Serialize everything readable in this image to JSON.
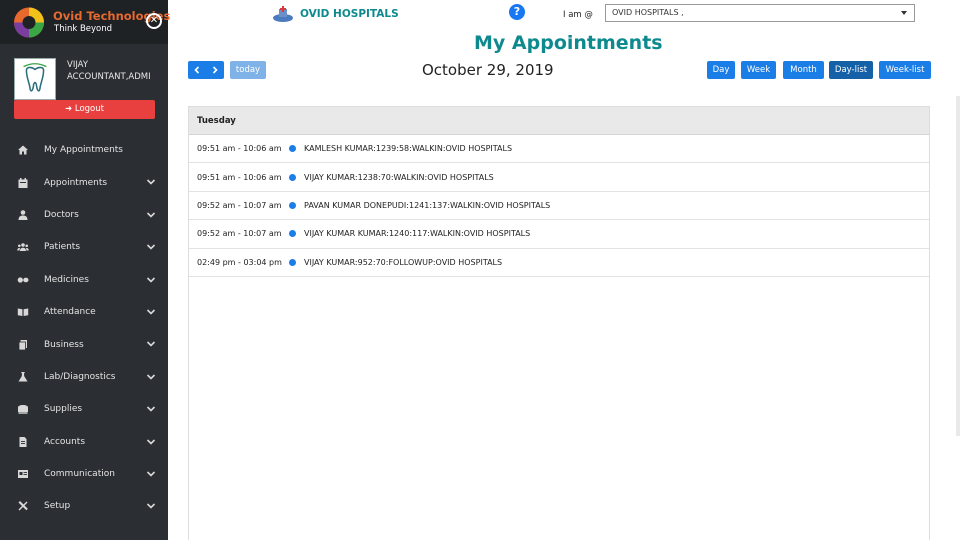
{
  "brand": {
    "name": "Ovid Technologies",
    "tagline": "Think Beyond"
  },
  "user": {
    "name": "VIJAY",
    "role": "ACCOUNTANT,ADMI",
    "logout_label": "Logout"
  },
  "sidebar": {
    "items": [
      {
        "label": "My Appointments",
        "icon": "home-icon",
        "expandable": false
      },
      {
        "label": "Appointments",
        "icon": "calendar-icon",
        "expandable": true
      },
      {
        "label": "Doctors",
        "icon": "doctor-icon",
        "expandable": true
      },
      {
        "label": "Patients",
        "icon": "users-icon",
        "expandable": true
      },
      {
        "label": "Medicines",
        "icon": "pills-icon",
        "expandable": true
      },
      {
        "label": "Attendance",
        "icon": "book-icon",
        "expandable": true
      },
      {
        "label": "Business",
        "icon": "copy-icon",
        "expandable": true
      },
      {
        "label": "Lab/Diagnostics",
        "icon": "flask-icon",
        "expandable": true
      },
      {
        "label": "Supplies",
        "icon": "truck-icon",
        "expandable": true
      },
      {
        "label": "Accounts",
        "icon": "file-icon",
        "expandable": true
      },
      {
        "label": "Communication",
        "icon": "message-icon",
        "expandable": true
      },
      {
        "label": "Setup",
        "icon": "tools-icon",
        "expandable": true
      }
    ]
  },
  "header": {
    "hospital_name": "OVID HOSPITALS",
    "iam_label": "I am @",
    "iam_value": "OVID HOSPITALS ,",
    "page_title": "My Appointments"
  },
  "toolbar": {
    "today_label": "today",
    "date_title": "October 29, 2019",
    "views": [
      "Day",
      "Week",
      "Month",
      "Day-list",
      "Week-list"
    ],
    "active_view": "Day-list"
  },
  "calendar": {
    "day_label": "Tuesday",
    "events": [
      {
        "time": "09:51 am - 10:06 am",
        "title": "KAMLESH KUMAR:1239:58:WALKIN:OVID HOSPITALS"
      },
      {
        "time": "09:51 am - 10:06 am",
        "title": "VIJAY KUMAR:1238:70:WALKIN:OVID HOSPITALS"
      },
      {
        "time": "09:52 am - 10:07 am",
        "title": "PAVAN KUMAR DONEPUDI:1241:137:WALKIN:OVID HOSPITALS"
      },
      {
        "time": "09:52 am - 10:07 am",
        "title": "VIJAY KUMAR KUMAR:1240:117:WALKIN:OVID HOSPITALS"
      },
      {
        "time": "02:49 pm - 03:04 pm",
        "title": "VIJAY KUMAR:952:70:FOLLOWUP:OVID HOSPITALS"
      }
    ]
  },
  "colors": {
    "accent": "#1a7ee6",
    "brand_teal": "#0e8a8f",
    "sidebar_bg": "#2b2f33",
    "logout_red": "#e8403e"
  }
}
